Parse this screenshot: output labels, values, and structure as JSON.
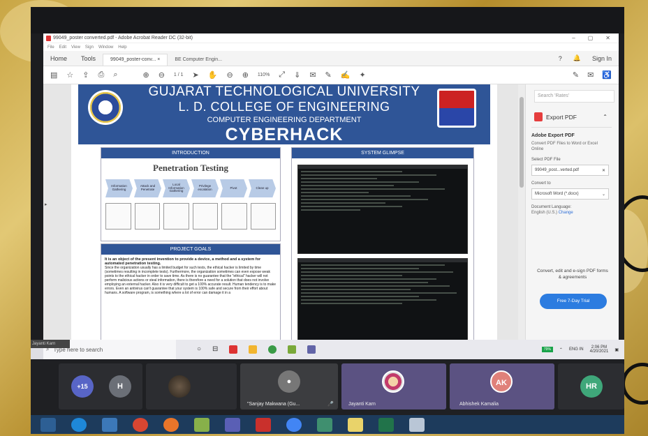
{
  "acrobat": {
    "title": "99049_poster converted.pdf - Adobe Acrobat Reader DC (32-bit)",
    "menu": [
      "File",
      "Edit",
      "View",
      "Sign",
      "Window",
      "Help"
    ],
    "window_controls": [
      "–",
      "▢",
      "✕"
    ],
    "tabs": {
      "home": "Home",
      "tools": "Tools",
      "doc_tab": "99049_poster-conv...",
      "doc_tab_close": "×",
      "doc_tab2": "BE Computer Engin...",
      "help": "?",
      "bell": "🔔",
      "sign_in": "Sign In"
    },
    "toolbar": {
      "page": "1 / 1",
      "zoom": "110%"
    }
  },
  "poster": {
    "line1": "GUJARAT TECHNOLOGICAL UNIVERSITY",
    "line2": "L. D. COLLEGE OF ENGINEERING",
    "line3": "COMPUTER ENGINEERING DEPARTMENT",
    "line4": "CYBERHACK",
    "intro_header": "INTRODUCTION",
    "pen_title": "Penetration Testing",
    "steps": [
      "Information Gathering",
      "Attack and Penetrate",
      "Local Information Gathering",
      "Privilege escalation",
      "Pivot",
      "Clean up"
    ],
    "goals_header": "PROJECT GOALS",
    "goals_lead": "It is an object of the present invention to provide a device, a method and a system for automated penetration testing.",
    "goals_body": "Since the organization usually has a limited budget for such tests, the ethical hacker is limited by time (sometimes resulting in incomplete tests). Furthermore, the organization sometimes can even expose weak points to the ethical hacker in order to save time. As there is no guarantee that the \"ethical\" hacker will not perform malicious actions or steal information, there is therefore a need for a solution that does not involve employing an external hacker. Also it is very difficult to get a 100% accurate result. Human tendency is to make errors. Even an antivirus can't guarantee that your system is 100% safe and secure from their effort about humans. A software program, is something where a lot of error can damage it in a",
    "glimpse_header": "SYSTEM GLIMPSE"
  },
  "side_panel": {
    "search_placeholder": "Search 'Rates'",
    "export_label": "Export PDF",
    "heading": "Adobe Export PDF",
    "desc": "Convert PDF Files to Word or Excel Online",
    "select_label": "Select PDF File",
    "file_value": "99049_post...verted.pdf",
    "convert_label": "Convert to",
    "convert_value": "Microsoft Word (*.docx)",
    "lang_label": "Document Language:",
    "lang_value": "English (U.S.)",
    "lang_change": "Change",
    "promo": "Convert, edit and e-sign PDF forms & agreements",
    "trial_button": "Free 7-Day Trial"
  },
  "taskbar": {
    "karn_label": "Jayanti Karn",
    "search_text": "Type here to search",
    "battery": "79%",
    "lang": "ENG IN",
    "time": "2:06 PM",
    "date": "4/20/2021"
  },
  "meeting": {
    "others_count": "+15",
    "p_h": "H",
    "p_sanjay": "\"Sanjay Makwana (Gu...",
    "p_jayanti": "Jayanti Karn",
    "p_ak_initials": "AK",
    "p_abhishek": "Abhishek Kamalia",
    "p_hr": "HR"
  },
  "colors": {
    "banner_blue": "#2f5597",
    "acrobat_red": "#e53d3d",
    "trial_blue": "#2c7ce0",
    "avatar_plus": "#5865c6",
    "avatar_h": "#6b6f77",
    "avatar_ak": "#e0817a",
    "avatar_hr": "#3fa77a"
  }
}
